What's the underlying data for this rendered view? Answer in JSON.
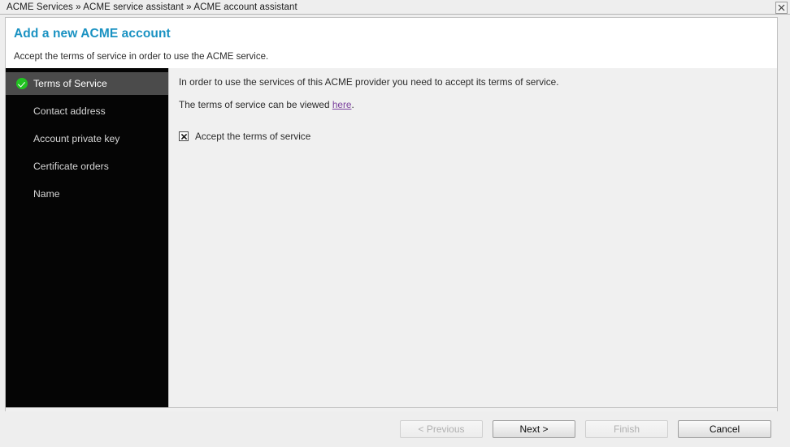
{
  "window": {
    "breadcrumb": "ACME Services » ACME service assistant » ACME account assistant",
    "close_icon": "close-icon"
  },
  "dialog": {
    "title": "Add a new ACME account",
    "subtitle": "Accept the terms of service in order to use the ACME service."
  },
  "sidebar": {
    "items": [
      {
        "label": "Terms of Service",
        "selected": true,
        "icon": "check-circle-icon"
      },
      {
        "label": "Contact address",
        "selected": false,
        "icon": ""
      },
      {
        "label": "Account private key",
        "selected": false,
        "icon": ""
      },
      {
        "label": "Certificate orders",
        "selected": false,
        "icon": ""
      },
      {
        "label": "Name",
        "selected": false,
        "icon": ""
      }
    ]
  },
  "content": {
    "paragraph1": "In order to use the services of this ACME provider you need to accept its terms of service.",
    "paragraph2_prefix": "The terms of service can be viewed ",
    "paragraph2_link": "here",
    "paragraph2_suffix": ".",
    "checkbox_label": "Accept the terms of service",
    "checkbox_checked": "checked"
  },
  "buttons": {
    "previous": "< Previous",
    "next": "Next >",
    "finish": "Finish",
    "cancel": "Cancel",
    "previous_state": "disabled",
    "next_state": "enabled",
    "finish_state": "disabled",
    "cancel_state": "enabled"
  },
  "colors": {
    "title_accent": "#1a92c2",
    "sidebar_bg": "#050505",
    "sidebar_selected_bg": "#4b4b4b",
    "check_green": "#21c321",
    "link_purple": "#7a3f9d",
    "content_bg": "#f0f0f0"
  }
}
